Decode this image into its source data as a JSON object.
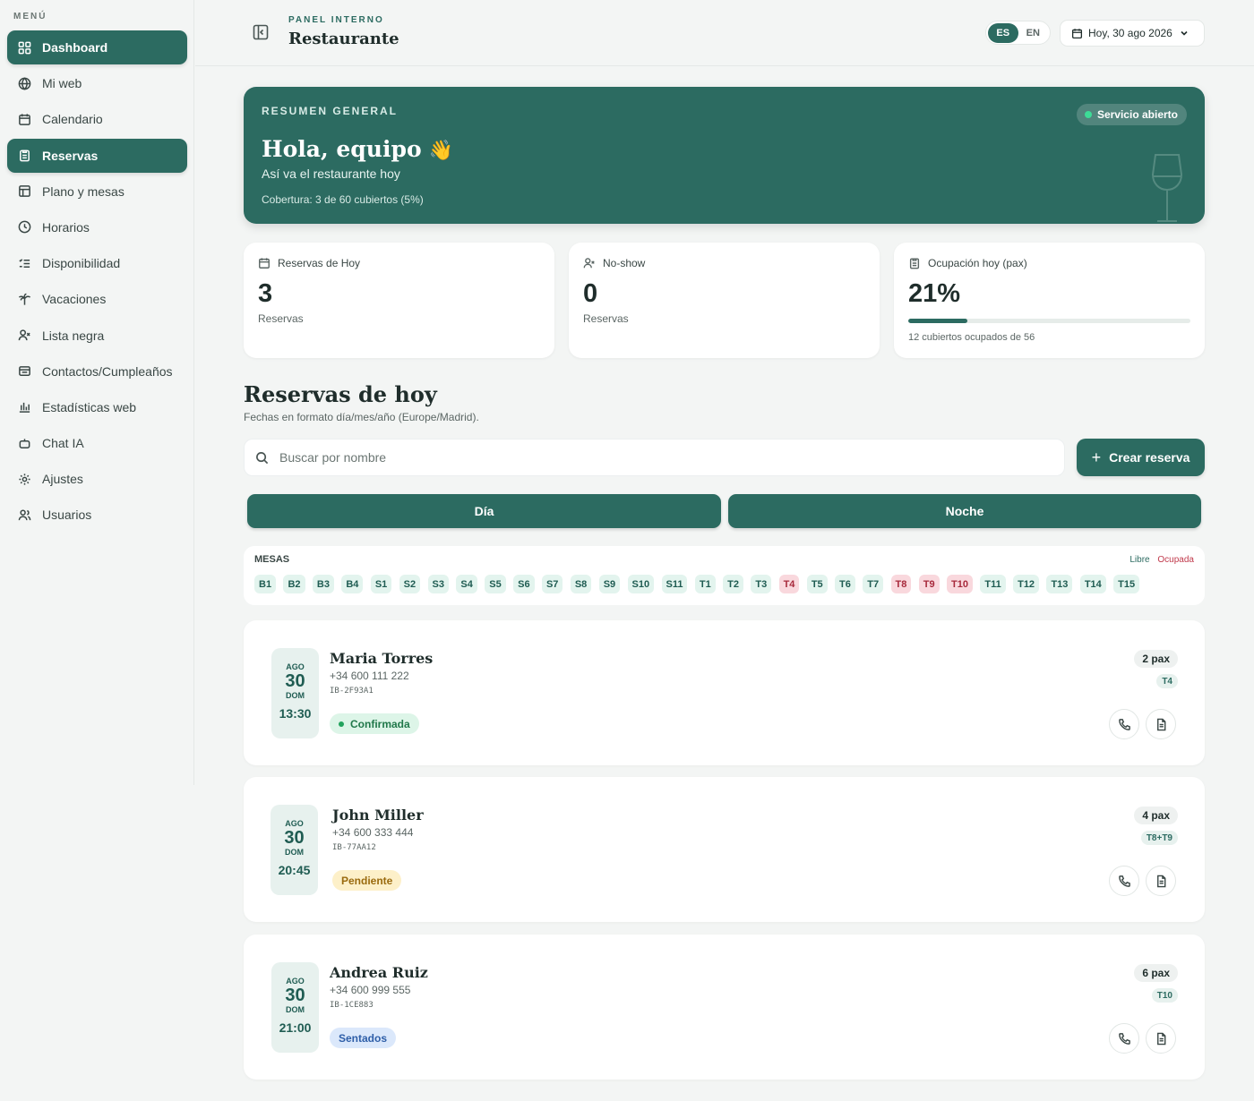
{
  "sidebar": {
    "menu_label": "MENÚ",
    "items": [
      {
        "label": "Dashboard",
        "icon": "grid-icon",
        "active": true
      },
      {
        "label": "Mi web",
        "icon": "globe-icon",
        "active": false
      },
      {
        "label": "Calendario",
        "icon": "calendar-icon",
        "active": false
      },
      {
        "label": "Reservas",
        "icon": "clipboard-icon",
        "active": true
      },
      {
        "label": "Plano y mesas",
        "icon": "layout-icon",
        "active": false
      },
      {
        "label": "Horarios",
        "icon": "clock-icon",
        "active": false
      },
      {
        "label": "Disponibilidad",
        "icon": "list-check-icon",
        "active": false
      },
      {
        "label": "Vacaciones",
        "icon": "palm-icon",
        "active": false
      },
      {
        "label": "Lista negra",
        "icon": "user-x-icon",
        "active": false
      },
      {
        "label": "Contactos/Cumpleaños",
        "icon": "contacts-icon",
        "active": false
      },
      {
        "label": "Estadísticas web",
        "icon": "bar-chart-icon",
        "active": false
      },
      {
        "label": "Chat IA",
        "icon": "bot-icon",
        "active": false
      },
      {
        "label": "Ajustes",
        "icon": "gear-icon",
        "active": false
      },
      {
        "label": "Usuarios",
        "icon": "users-icon",
        "active": false
      }
    ]
  },
  "header": {
    "panel_label": "PANEL INTERNO",
    "title": "Restaurante",
    "lang_es": "ES",
    "lang_en": "EN",
    "date_label": "Hoy, 30 ago 2026"
  },
  "hero": {
    "label": "RESUMEN GENERAL",
    "title": "Hola, equipo",
    "wave": "👋",
    "subtitle": "Así va el restaurante hoy",
    "coverage": "Cobertura: 3 de 60 cubiertos (5%)",
    "badge": "Servicio abierto"
  },
  "stats": {
    "today": {
      "title": "Reservas de Hoy",
      "value": "3",
      "sub": "Reservas"
    },
    "noshow": {
      "title": "No-show",
      "value": "0",
      "sub": "Reservas"
    },
    "occupancy": {
      "title": "Ocupación hoy (pax)",
      "value": "21%",
      "progress": 21,
      "small": "12 cubiertos ocupados de 56"
    }
  },
  "section": {
    "title": "Reservas de hoy",
    "subtitle": "Fechas en formato día/mes/año (Europe/Madrid)."
  },
  "search": {
    "placeholder": "Buscar por nombre",
    "value": ""
  },
  "create_button": "Crear reserva",
  "shifts": {
    "day": "Día",
    "night": "Noche"
  },
  "tables": {
    "label": "MESAS",
    "legend_free": "Libre",
    "legend_occupied": "Ocupada",
    "chips": [
      {
        "t": "B1",
        "o": false
      },
      {
        "t": "B2",
        "o": false
      },
      {
        "t": "B3",
        "o": false
      },
      {
        "t": "B4",
        "o": false
      },
      {
        "t": "S1",
        "o": false
      },
      {
        "t": "S2",
        "o": false
      },
      {
        "t": "S3",
        "o": false
      },
      {
        "t": "S4",
        "o": false
      },
      {
        "t": "S5",
        "o": false
      },
      {
        "t": "S6",
        "o": false
      },
      {
        "t": "S7",
        "o": false
      },
      {
        "t": "S8",
        "o": false
      },
      {
        "t": "S9",
        "o": false
      },
      {
        "t": "S10",
        "o": false
      },
      {
        "t": "S11",
        "o": false
      },
      {
        "t": "T1",
        "o": false
      },
      {
        "t": "T2",
        "o": false
      },
      {
        "t": "T3",
        "o": false
      },
      {
        "t": "T4",
        "o": true
      },
      {
        "t": "T5",
        "o": false
      },
      {
        "t": "T6",
        "o": false
      },
      {
        "t": "T7",
        "o": false
      },
      {
        "t": "T8",
        "o": true
      },
      {
        "t": "T9",
        "o": true
      },
      {
        "t": "T10",
        "o": true
      },
      {
        "t": "T11",
        "o": false
      },
      {
        "t": "T12",
        "o": false
      },
      {
        "t": "T13",
        "o": false
      },
      {
        "t": "T14",
        "o": false
      },
      {
        "t": "T15",
        "o": false
      }
    ]
  },
  "reservations": [
    {
      "month": "AGO",
      "day": "30",
      "dow": "DOM",
      "time": "13:30",
      "name": "Maria Torres",
      "phone": "+34 600 111 222",
      "code": "IB-2F93A1",
      "status": "Confirmada",
      "pax": "2 pax",
      "table": "T4"
    },
    {
      "month": "AGO",
      "day": "30",
      "dow": "DOM",
      "time": "20:45",
      "name": "John Miller",
      "phone": "+34 600 333 444",
      "code": "IB-77AA12",
      "status": "Pendiente",
      "pax": "4 pax",
      "table": "T8+T9"
    },
    {
      "month": "AGO",
      "day": "30",
      "dow": "DOM",
      "time": "21:00",
      "name": "Andrea Ruiz",
      "phone": "+34 600 999 555",
      "code": "IB-1CE883",
      "status": "Sentados",
      "pax": "6 pax",
      "table": "T10"
    }
  ],
  "colors": {
    "brand": "#2c6b61",
    "occupied": "#a7293b",
    "free": "#1f5c52"
  }
}
